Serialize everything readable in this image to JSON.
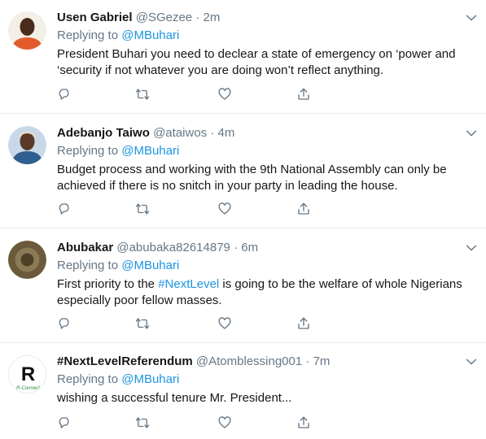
{
  "tweets": [
    {
      "name": "Usen Gabriel",
      "handle": "@SGezee",
      "dot": "·",
      "time": "2m",
      "replying_label": "Replying to",
      "mention": "@MBuhari",
      "text": "President Buhari you need to declear a state of emergency on ‘power and ‘security if not whatever you are doing won’t reflect anything.",
      "avatar_color": "#e35b2b"
    },
    {
      "name": "Adebanjo Taiwo",
      "handle": "@ataiwos",
      "dot": "·",
      "time": "4m",
      "replying_label": "Replying to",
      "mention": "@MBuhari",
      "text": "Budget process and working with the 9th National Assembly can only be achieved if there is no snitch in your party in leading the house.",
      "avatar_color": "#7a9cc2"
    },
    {
      "name": "Abubakar",
      "handle": "@abubaka82614879",
      "dot": "·",
      "time": "6m",
      "replying_label": "Replying to",
      "mention": "@MBuhari",
      "text_before": "First priority to the ",
      "hashtag": "#NextLevel",
      "text_after": " is going to be the welfare of whole Nigerians especially poor fellow masses.",
      "avatar_color": "#6b5a3a"
    },
    {
      "name": "#NextLevelReferendum",
      "handle": "@Atomblessing001",
      "dot": "·",
      "time": "7m",
      "replying_label": "Replying to",
      "mention": "@MBuhari",
      "text": "wishing a successful tenure Mr. President...",
      "avatar_logo_letter": "R",
      "avatar_logo_caption": "R-Connect"
    }
  ],
  "colors": {
    "link": "#1b95e0",
    "muted": "#657786",
    "text": "#14171a",
    "border": "#e6ecf0"
  },
  "icons": [
    "chevron-down-icon",
    "reply-icon",
    "retweet-icon",
    "like-icon",
    "share-icon"
  ]
}
